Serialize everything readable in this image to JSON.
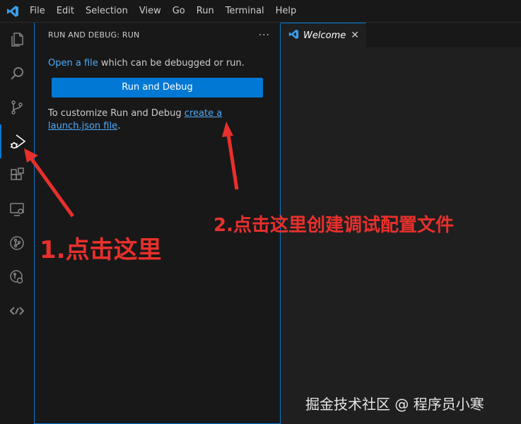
{
  "menu": [
    "File",
    "Edit",
    "Selection",
    "View",
    "Go",
    "Run",
    "Terminal",
    "Help"
  ],
  "activity_bar": [
    {
      "icon": "files-icon"
    },
    {
      "icon": "search-icon"
    },
    {
      "icon": "source-control-icon"
    },
    {
      "icon": "run-debug-icon",
      "active": true
    },
    {
      "icon": "extensions-icon"
    },
    {
      "icon": "remote-explorer-icon"
    },
    {
      "icon": "git-graph-icon"
    },
    {
      "icon": "testing-icon"
    },
    {
      "icon": "live-share-icon"
    }
  ],
  "sidebar": {
    "title": "RUN AND DEBUG: RUN",
    "more": "···",
    "open_link": "Open a file",
    "open_rest": " which can be debugged or run.",
    "button": "Run and Debug",
    "customize_text": "To customize Run and Debug ",
    "launch_link": "create a launch.json file",
    "period": "."
  },
  "tab": {
    "label": "Welcome",
    "close": "✕"
  },
  "annotations": {
    "step1": "1.点击这里",
    "step2": "2.点击这里创建调试配置文件",
    "color": "#e8302c"
  },
  "watermark": "掘金技术社区 @ 程序员小寒",
  "colors": {
    "accent": "#0078d4",
    "link": "#4daafc",
    "background": "#181818"
  }
}
